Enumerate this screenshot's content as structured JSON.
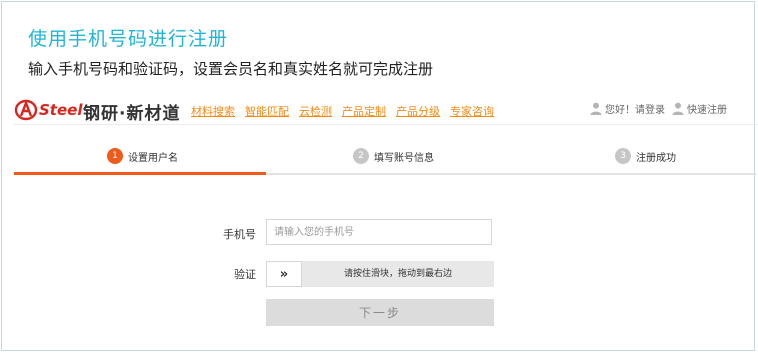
{
  "intro": {
    "title": "使用手机号码进行注册",
    "subtitle": "输入手机号码和验证码，设置会员名和真实姓名就可完成注册"
  },
  "header": {
    "logo_text": "Steel",
    "brand": "钢研·新材道",
    "nav": [
      "材料搜索",
      "智能匹配",
      "云检测",
      "产品定制",
      "产品分级",
      "专家咨询"
    ],
    "greeting_login": "您好！请登录",
    "quick_register": "快速注册",
    "logo_color": "#d7261e",
    "nav_color": "#f08b16"
  },
  "steps": [
    {
      "number": "1",
      "label": "设置用户名",
      "active": true
    },
    {
      "number": "2",
      "label": "填写账号信息",
      "active": false
    },
    {
      "number": "3",
      "label": "注册成功",
      "active": false
    }
  ],
  "form": {
    "phone_label": "手机号",
    "phone_placeholder": "请输入您的手机号",
    "phone_value": "",
    "verify_label": "验证",
    "slider_handle_icon": "double-chevron-right-icon",
    "slider_handle_glyph": "»",
    "slider_text": "请按住滑块，拖动到最右边",
    "next_label": "下一步"
  },
  "colors": {
    "accent": "#f05a1a",
    "title": "#1fb6d6"
  }
}
